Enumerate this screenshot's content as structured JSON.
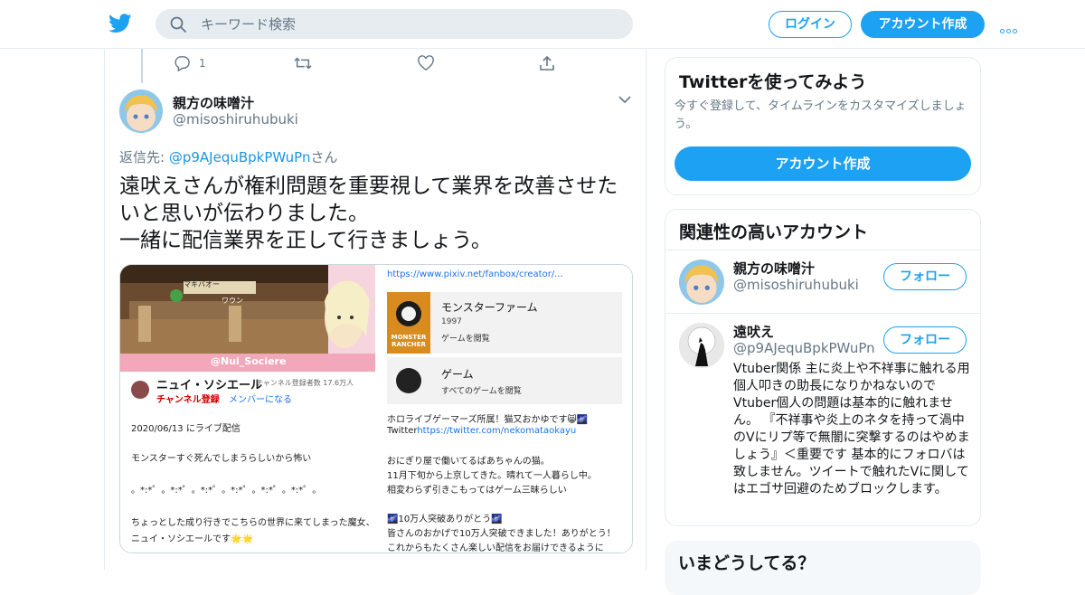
{
  "header": {
    "search_placeholder": "キーワード検索",
    "login_label": "ログイン",
    "signup_label": "アカウント作成",
    "accent_color": "#1da1f2"
  },
  "prev_tweet": {
    "reply_count": "1"
  },
  "tweet": {
    "author_name": "親方の味噌汁",
    "author_handle": "@misoshiruhubuki",
    "reply_prefix": "返信先: ",
    "reply_handle": "@p9AJequBpkPWuPn",
    "reply_suffix": "さん",
    "text": "遠吠えさんが権利問題を重要視して業界を改善させたいと思いが伝わりました。\n一緒に配信業界を正して行きましょう。",
    "media": {
      "game_name_tag": "マキバオー",
      "game_sub_tag": "ワウン",
      "twitter_tag": "@Nui_Sociere",
      "channel_name": "ニュイ・ソシエール",
      "subscribers": "チャンネル登録者数 17.6万人",
      "subscribe_label": "チャンネル登録",
      "member_label": "メンバーになる",
      "stream_date": "2020/06/13 にライブ配信",
      "line1": "モンスターすぐ死んでしまうらしいから怖い",
      "line2": "。*:*゜。*:*゜。*:*゜。*:*゜。*:*゜。*:*゜。",
      "line3": "ちょっとした成り行きでこちらの世界に来てしまった魔女、",
      "line4": "ニュイ・ソシエールです🌟🌟",
      "fanbox_url": "https://www.pixiv.net/fanbox/creator/...",
      "game_title": "モンスターファーム",
      "game_year": "1997",
      "game_browse": "ゲームを閲覧",
      "game_cover_text": "MONSTER RANCHER",
      "game_cat": "ゲーム",
      "game_cat_browse": "すべてのゲームを閲覧",
      "desc1": "ホロライブゲーマーズ所属！猫又おかゆです😸🌌",
      "desc2_prefix": "Twitter",
      "desc2_link": "https://twitter.com/nekomataokayu",
      "desc3": "おにぎり屋で働いてるばあちゃんの猫。",
      "desc4": "11月下旬から上京してきた。晴れて一人暮らし中。",
      "desc5": "相変わらず引きこもってはゲーム三昧らしい",
      "desc6": "🌌10万人突破ありがとう🌌",
      "desc7": "皆さんのおかげで10万人突破できました！ありがとう！",
      "desc8": "これからもたくさん楽しい配信をお届けできるように"
    }
  },
  "sidebar": {
    "try_title": "Twitterを使ってみよう",
    "try_sub": "今すぐ登録して、タイムラインをカスタマイズしましょう。",
    "try_button": "アカウント作成",
    "related_title": "関連性の高いアカウント",
    "accounts": [
      {
        "name": "親方の味噌汁",
        "handle": "@misoshiruhubuki",
        "follow": "フォロー"
      },
      {
        "name": "遠吠え",
        "handle": "@p9AJequBpkPWuPn",
        "follow": "フォロー",
        "bio": "Vtuber関係 主に炎上や不祥事に触れる用 個人叩きの助長になりかねないのでVtuber個人の問題は基本的に触れません。 『不祥事や炎上のネタを持って渦中のVにリプ等で無闇に突撃するのはやめましょう』＜重要です 基本的にフォロバは致しません。ツイートで触れたVに関してはエゴサ回避のためブロックします。"
      }
    ],
    "whats_happening": "いまどうしてる？"
  }
}
